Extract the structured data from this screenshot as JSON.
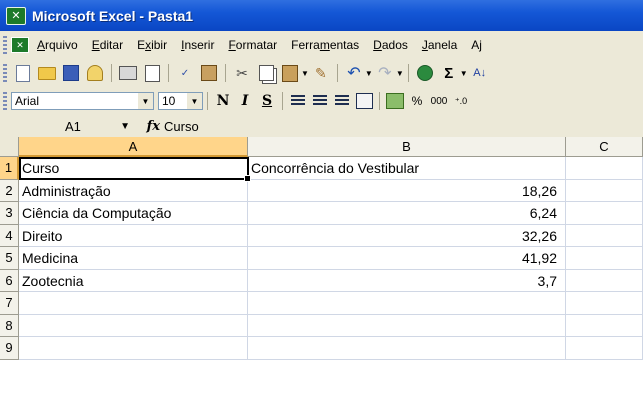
{
  "window": {
    "title": "Microsoft Excel - Pasta1"
  },
  "menu": [
    {
      "label": "Arquivo",
      "accel": "A"
    },
    {
      "label": "Editar",
      "accel": "E"
    },
    {
      "label": "Exibir",
      "accel": "x"
    },
    {
      "label": "Inserir",
      "accel": "I"
    },
    {
      "label": "Formatar",
      "accel": "F"
    },
    {
      "label": "Ferramentas",
      "accel": "m"
    },
    {
      "label": "Dados",
      "accel": "D"
    },
    {
      "label": "Janela",
      "accel": "J"
    },
    {
      "label": "Aj",
      "accel": ""
    }
  ],
  "format_toolbar": {
    "font": "Arial",
    "size": "10",
    "bold": "N",
    "italic": "I",
    "underline": "S",
    "percent": "%",
    "thousands": "000"
  },
  "formula_bar": {
    "name_box": "A1",
    "fx": "fx",
    "content": "Curso"
  },
  "columns": [
    "A",
    "B",
    "C"
  ],
  "rows": [
    "1",
    "2",
    "3",
    "4",
    "5",
    "6",
    "7",
    "8",
    "9"
  ],
  "cells": [
    [
      "Curso",
      "Concorrência do Vestibular",
      ""
    ],
    [
      "Administração",
      "18,26",
      ""
    ],
    [
      "Ciência da Computação",
      "6,24",
      ""
    ],
    [
      "Direito",
      "32,26",
      ""
    ],
    [
      "Medicina",
      "41,92",
      ""
    ],
    [
      "Zootecnia",
      "3,7",
      ""
    ],
    [
      "",
      "",
      ""
    ],
    [
      "",
      "",
      ""
    ],
    [
      "",
      "",
      ""
    ]
  ],
  "colors": {
    "titlebar": "#0a46c4",
    "chrome": "#ece9d8",
    "active_header": "#ffd58a",
    "gridline": "#d0d7e5"
  }
}
